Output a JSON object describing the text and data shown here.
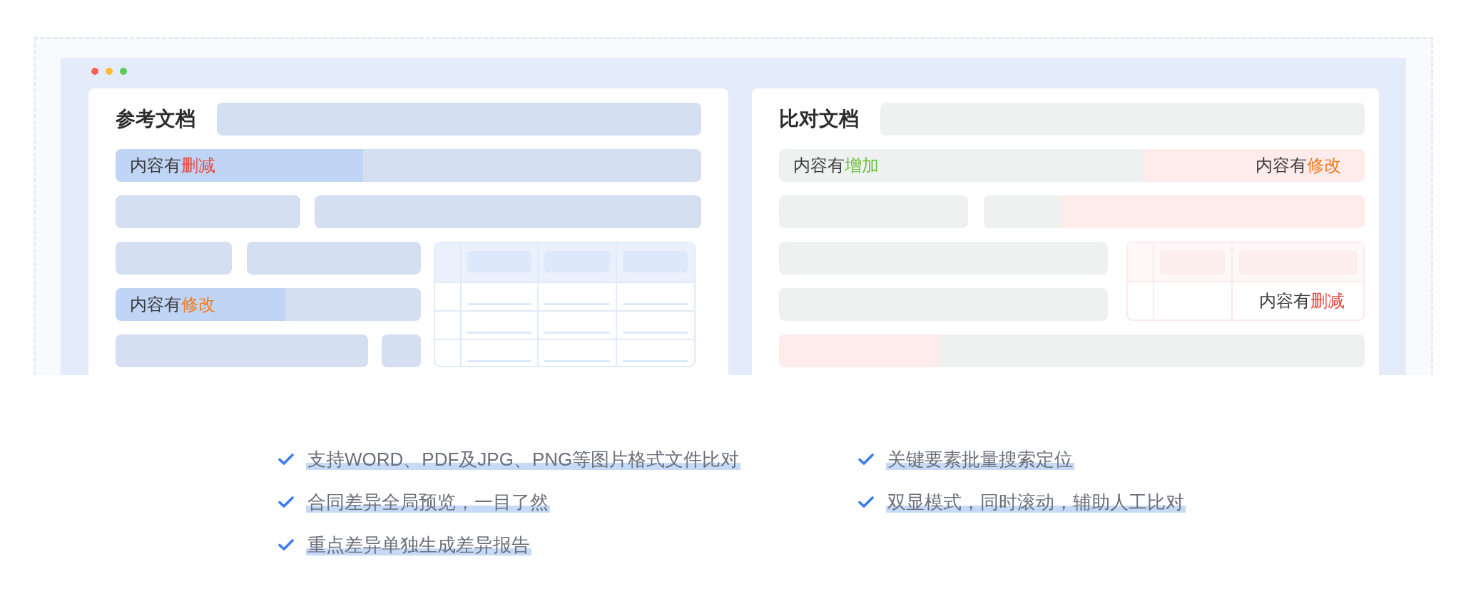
{
  "window_controls": [
    {
      "color": "#fe5f57"
    },
    {
      "color": "#fdbc2f"
    },
    {
      "color": "#5bc95a"
    }
  ],
  "reference_document": {
    "title": "参考文档",
    "changes": [
      {
        "prefix": "内容有",
        "word": "删减",
        "kind": "deleted"
      },
      {
        "prefix": "内容有",
        "word": "修改",
        "kind": "modified"
      }
    ]
  },
  "compared_document": {
    "title": "比对文档",
    "changes": [
      {
        "prefix": "内容有",
        "word": "增加",
        "kind": "added"
      },
      {
        "prefix": "内容有",
        "word": "修改",
        "kind": "modified"
      },
      {
        "prefix": "内容有",
        "word": "删减",
        "kind": "deleted"
      }
    ]
  },
  "features": [
    {
      "text": "支持WORD、PDF及JPG、PNG等图片格式文件比对"
    },
    {
      "text": "合同差异全局预览，一目了然"
    },
    {
      "text": "重点差异单独生成差异报告"
    },
    {
      "text": "关键要素批量搜索定位"
    },
    {
      "text": "双显模式，同时滚动，辅助人工比对"
    }
  ]
}
